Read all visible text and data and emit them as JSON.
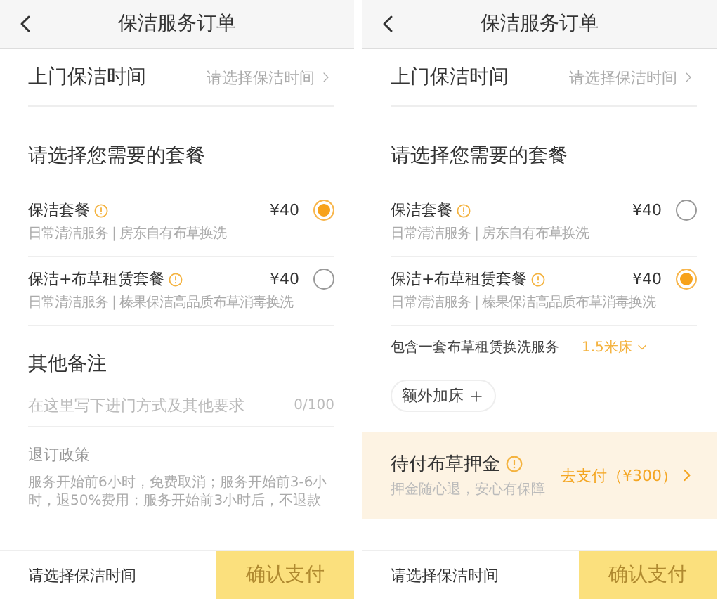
{
  "screens": [
    {
      "header": {
        "title": "保洁服务订单"
      },
      "time_row": {
        "label": "上门保洁时间",
        "value": "请选择保洁时间"
      },
      "section_title": "请选择您需要的套餐",
      "packages": [
        {
          "name": "保洁套餐",
          "price": "¥40",
          "description": "日常清洁服务 | 房东自有布草换洗",
          "selected": true
        },
        {
          "name": "保洁+布草租赁套餐",
          "price": "¥40",
          "description": "日常清洁服务 | 榛果保洁高品质布草消毒换洗",
          "selected": false
        }
      ],
      "extras": [
        {
          "kind": "notes",
          "title": "其他备注",
          "placeholder": "在这里写下进门方式及其他要求",
          "counter": "0/100"
        },
        {
          "kind": "policy",
          "title": "退订政策",
          "text": "服务开始前6小时，免费取消；服务开始前3-6小时，退50%费用；服务开始前3小时后，不退款"
        }
      ],
      "footer": {
        "hint": "请选择保洁时间",
        "button": "确认支付"
      }
    },
    {
      "header": {
        "title": "保洁服务订单"
      },
      "time_row": {
        "label": "上门保洁时间",
        "value": "请选择保洁时间"
      },
      "section_title": "请选择您需要的套餐",
      "packages": [
        {
          "name": "保洁套餐",
          "price": "¥40",
          "description": "日常清洁服务 | 房东自有布草换洗",
          "selected": false
        },
        {
          "name": "保洁+布草租赁套餐",
          "price": "¥40",
          "description": "日常清洁服务 | 榛果保洁高品质布草消毒换洗",
          "selected": true
        }
      ],
      "extras": [
        {
          "kind": "bed_option",
          "label": "包含一套布草租赁换洗服务",
          "value": "1.5米床"
        },
        {
          "kind": "add_bed",
          "label": "额外加床"
        },
        {
          "kind": "deposit",
          "title": "待付布草押金",
          "subtitle": "押金随心退，安心有保障",
          "action": "去支付（¥300）"
        }
      ],
      "footer": {
        "hint": "请选择保洁时间",
        "button": "确认支付"
      }
    }
  ]
}
